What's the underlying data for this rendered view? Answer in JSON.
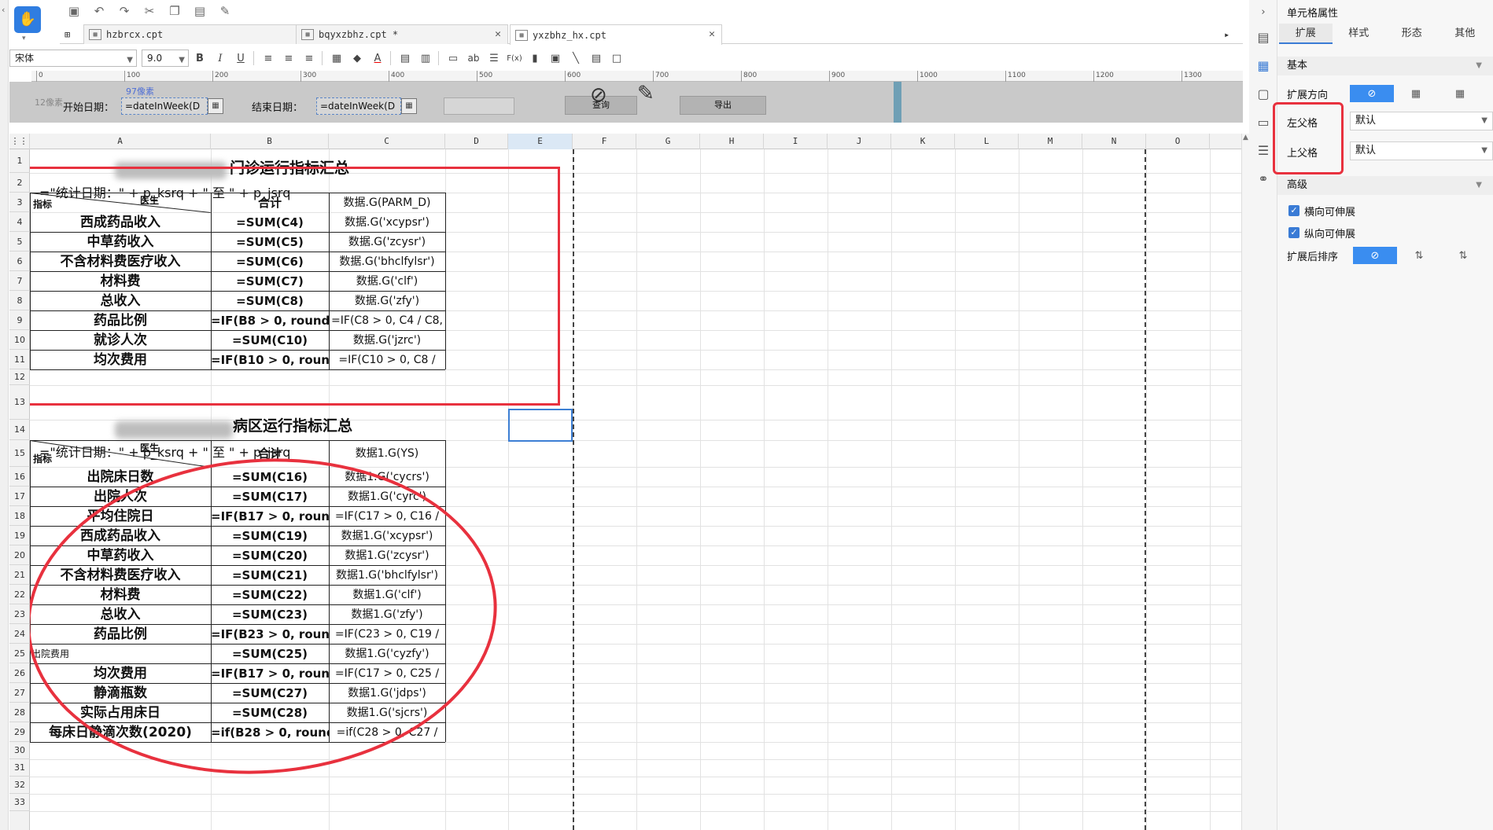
{
  "toolbar": {
    "logo_caption": "97像素",
    "font": "宋体",
    "font_size": "9.0",
    "bold": "B",
    "italic": "I",
    "underline": "U",
    "text_style": "ab",
    "formula": "F(x)"
  },
  "tabs": [
    {
      "label": "hzbrcx.cpt"
    },
    {
      "label": "bqyxzbhz.cpt *"
    },
    {
      "label": "yxzbhz_hx.cpt"
    }
  ],
  "ruler": [
    "0",
    "100",
    "200",
    "300",
    "400",
    "500",
    "600",
    "700",
    "800",
    "900",
    "1000",
    "1100",
    "1200",
    "1300"
  ],
  "params": {
    "width_px": "97像素",
    "label_px": "12像素",
    "start_label": "开始日期：",
    "start_value": "=dateInWeek(D",
    "end_label": "结束日期：",
    "end_value": "=dateInWeek(D",
    "query_btn": "查询",
    "export_btn": "导出"
  },
  "columns": [
    "A",
    "B",
    "C",
    "D",
    "E",
    "F",
    "G",
    "H",
    "I",
    "J",
    "K",
    "L",
    "M",
    "N",
    "O"
  ],
  "rows": [
    "1",
    "2",
    "3",
    "4",
    "5",
    "6",
    "7",
    "8",
    "9",
    "10",
    "11",
    "12",
    "13",
    "14",
    "15",
    "16",
    "17",
    "18",
    "19",
    "20",
    "21",
    "22",
    "23",
    "24",
    "25",
    "26",
    "27",
    "28",
    "29",
    "30",
    "31",
    "32",
    "33"
  ],
  "sheet": {
    "title1": "门诊运行指标汇总",
    "subtitle1": "=\"统计日期：\" + p_ksrq + \" 至 \" + p_jsrq",
    "hdr_doctor": "医生",
    "hdr_index": "指标",
    "hdr_total": "合计",
    "hdr_c1": "数据.G(PARM_D)",
    "block1": [
      {
        "label": "西成药品收入",
        "total": "=SUM(C4)",
        "data": "数据.G('xcypsr')"
      },
      {
        "label": "中草药收入",
        "total": "=SUM(C5)",
        "data": "数据.G('zcysr')"
      },
      {
        "label": "不含材料费医疗收入",
        "total": "=SUM(C6)",
        "data": "数据.G('bhclfylsr')"
      },
      {
        "label": "材料费",
        "total": "=SUM(C7)",
        "data": "数据.G('clf')"
      },
      {
        "label": "总收入",
        "total": "=SUM(C8)",
        "data": "数据.G('zfy')"
      },
      {
        "label": "药品比例",
        "total": "=IF(B8 > 0, round(",
        "data": "=IF(C8 > 0, C4 / C8,"
      },
      {
        "label": "就诊人次",
        "total": "=SUM(C10)",
        "data": "数据.G('jzrc')"
      },
      {
        "label": "均次费用",
        "total": "=IF(B10 > 0, roun",
        "data": "=IF(C10 > 0, C8 /"
      }
    ],
    "title2": "病区运行指标汇总",
    "subtitle2": "=\"统计日期：\" + p_ksrq + \" 至 \" + p_jsrq",
    "hdr_c2": "数据1.G(YS)",
    "block2": [
      {
        "label": "出院床日数",
        "total": "=SUM(C16)",
        "data": "数据1.G('cycrs')"
      },
      {
        "label": "出院人次",
        "total": "=SUM(C17)",
        "data": "数据1.G('cyrc')"
      },
      {
        "label": "平均住院日",
        "total": "=IF(B17 > 0, roun",
        "data": "=IF(C17 > 0, C16 /"
      },
      {
        "label": "西成药品收入",
        "total": "=SUM(C19)",
        "data": "数据1.G('xcypsr')"
      },
      {
        "label": "中草药收入",
        "total": "=SUM(C20)",
        "data": "数据1.G('zcysr')"
      },
      {
        "label": "不含材料费医疗收入",
        "total": "=SUM(C21)",
        "data": "数据1.G('bhclfylsr')"
      },
      {
        "label": "材料费",
        "total": "=SUM(C22)",
        "data": "数据1.G('clf')"
      },
      {
        "label": "总收入",
        "total": "=SUM(C23)",
        "data": "数据1.G('zfy')"
      },
      {
        "label": "药品比例",
        "total": "=IF(B23 > 0, roun",
        "data": "=IF(C23 > 0, C19 /"
      },
      {
        "label": "出院费用",
        "total": "=SUM(C25)",
        "data": "数据1.G('cyzfy')"
      },
      {
        "label": "均次费用",
        "total": "=IF(B17 > 0, roun",
        "data": "=IF(C17 > 0, C25 /"
      },
      {
        "label": "静滴瓶数",
        "total": "=SUM(C27)",
        "data": "数据1.G('jdps')"
      },
      {
        "label": "实际占用床日",
        "total": "=SUM(C28)",
        "data": "数据1.G('sjcrs')"
      },
      {
        "label": "每床日静滴次数(2020)",
        "total": "=if(B28 > 0, round(",
        "data": "=if(C28 > 0, C27 /"
      }
    ]
  },
  "panel": {
    "title": "单元格属性",
    "tabs": [
      "扩展",
      "样式",
      "形态",
      "其他"
    ],
    "section_basic": "基本",
    "expand_dir": "扩展方向",
    "left_parent": "左父格",
    "left_parent_value": "默认",
    "up_parent": "上父格",
    "up_parent_value": "默认",
    "section_adv": "高级",
    "h_expand": "横向可伸展",
    "v_expand": "纵向可伸展",
    "sort_after": "扩展后排序"
  },
  "colors": {
    "accent": "#3a8df0",
    "annotation": "#e8313e"
  }
}
